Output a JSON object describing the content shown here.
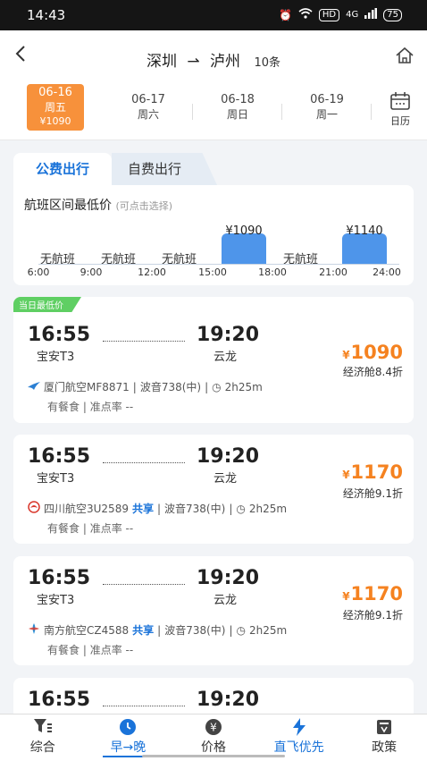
{
  "status": {
    "time": "14:43",
    "wifi": "WiFi",
    "hd": "HD",
    "signal": "4G",
    "battery": "75"
  },
  "header": {
    "from": "深圳",
    "to": "泸州",
    "count": "10条"
  },
  "dates": [
    {
      "date": "06-16",
      "weekday": "周五",
      "price": "¥1090",
      "active": true
    },
    {
      "date": "06-17",
      "weekday": "周六"
    },
    {
      "date": "06-18",
      "weekday": "周日"
    },
    {
      "date": "06-19",
      "weekday": "周一"
    }
  ],
  "calendar_label": "日历",
  "tabs": {
    "public": "公费出行",
    "self": "自费出行"
  },
  "range": {
    "title": "航班区间最低价",
    "hint": "(可点击选择)",
    "slots": [
      "无航班",
      "无航班",
      "无航班",
      "¥1090",
      "无航班",
      "¥1140"
    ],
    "ticks": [
      "6:00",
      "9:00",
      "12:00",
      "15:00",
      "18:00",
      "21:00",
      "24:00"
    ]
  },
  "flights": [
    {
      "badge": "当日最低价",
      "dep_time": "16:55",
      "dep_airport": "宝安T3",
      "arr_time": "19:20",
      "arr_airport": "云龙",
      "yen": "¥",
      "price": "1090",
      "cabin": "经济舱8.4折",
      "airline": "厦门航空MF8871",
      "share": "",
      "plane": "波音738(中)",
      "duration": "2h25m",
      "meal": "有餐食",
      "ontime": "准点率 --"
    },
    {
      "badge": "",
      "dep_time": "16:55",
      "dep_airport": "宝安T3",
      "arr_time": "19:20",
      "arr_airport": "云龙",
      "yen": "¥",
      "price": "1170",
      "cabin": "经济舱9.1折",
      "airline": "四川航空3U2589",
      "share": "共享",
      "plane": "波音738(中)",
      "duration": "2h25m",
      "meal": "有餐食",
      "ontime": "准点率 --"
    },
    {
      "badge": "",
      "dep_time": "16:55",
      "dep_airport": "宝安T3",
      "arr_time": "19:20",
      "arr_airport": "云龙",
      "yen": "¥",
      "price": "1170",
      "cabin": "经济舱9.1折",
      "airline": "南方航空CZ4588",
      "share": "共享",
      "plane": "波音738(中)",
      "duration": "2h25m",
      "meal": "有餐食",
      "ontime": "准点率 --"
    },
    {
      "dep_time": "16:55",
      "arr_time": "19:20"
    }
  ],
  "tabbar": [
    "综合",
    "早→晚",
    "价格",
    "直飞优先",
    "政策"
  ],
  "colors": {
    "accent": "#1a73d9",
    "price": "#f58220",
    "active_date": "#f7913b",
    "badge": "#5fcf63"
  }
}
